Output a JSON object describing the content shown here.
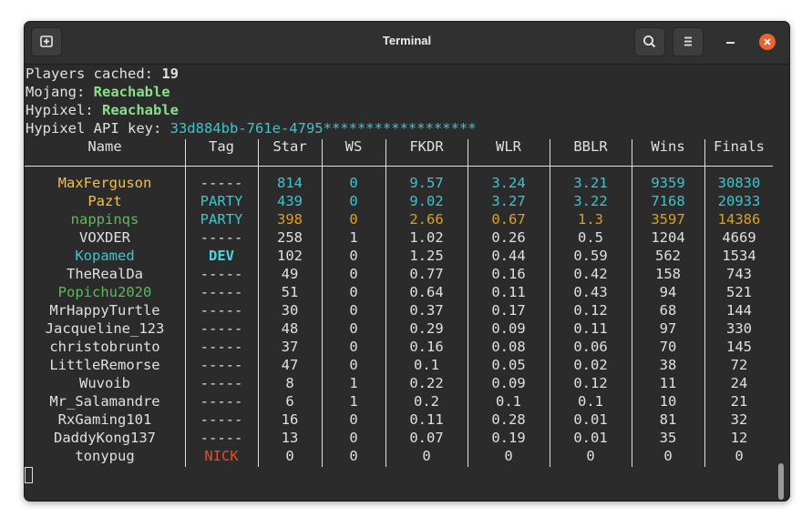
{
  "window": {
    "title": "Terminal"
  },
  "header_lines": [
    {
      "label": "Players cached: ",
      "value": "19",
      "value_style": "b"
    },
    {
      "label": "Mojang: ",
      "value": "Reachable",
      "value_style": "green"
    },
    {
      "label": "Hypixel: ",
      "value": "Reachable",
      "value_style": "green"
    },
    {
      "label": "Hypixel API key: ",
      "value": "33d884bb-761e-4795******************",
      "value_style": "cyan"
    }
  ],
  "table": {
    "columns": [
      "Name",
      "Tag",
      "Star",
      "WS",
      "FKDR",
      "WLR",
      "BBLR",
      "Wins",
      "Finals"
    ],
    "colors": {
      "default": "#e0e0e0",
      "gold": "#f1c04a",
      "cyan": "#3ec4d0",
      "orange": "#e0a020",
      "green": "#5fb95f",
      "red": "#e0502e",
      "aqua_bold": "#49d6e0"
    },
    "rows": [
      {
        "name": "MaxFerguson",
        "name_color": "gold",
        "tag": "-----",
        "tag_color": "default",
        "stats_color": "cyan",
        "star": "814",
        "ws": "0",
        "fkdr": "9.57",
        "wlr": "3.24",
        "bblr": "3.21",
        "wins": "9359",
        "finals": "30830"
      },
      {
        "name": "Pazt",
        "name_color": "gold",
        "tag": "PARTY",
        "tag_color": "cyan",
        "stats_color": "cyan",
        "star": "439",
        "ws": "0",
        "fkdr": "9.02",
        "wlr": "3.27",
        "bblr": "3.22",
        "wins": "7168",
        "finals": "20933"
      },
      {
        "name": "nappinqs",
        "name_color": "green",
        "tag": "PARTY",
        "tag_color": "cyan",
        "stats_color": "orange",
        "star": "398",
        "ws": "0",
        "fkdr": "2.66",
        "wlr": "0.67",
        "bblr": "1.3",
        "wins": "3597",
        "finals": "14386"
      },
      {
        "name": "VOXDER",
        "name_color": "default",
        "tag": "-----",
        "tag_color": "default",
        "stats_color": "default",
        "star": "258",
        "ws": "1",
        "fkdr": "1.02",
        "wlr": "0.26",
        "bblr": "0.5",
        "wins": "1204",
        "finals": "4669"
      },
      {
        "name": "Kopamed",
        "name_color": "cyan",
        "tag": "DEV",
        "tag_color": "aqua_bold",
        "stats_color": "default",
        "star": "102",
        "ws": "0",
        "fkdr": "1.25",
        "wlr": "0.44",
        "bblr": "0.59",
        "wins": "562",
        "finals": "1534"
      },
      {
        "name": "TheRealDa",
        "name_color": "default",
        "tag": "-----",
        "tag_color": "default",
        "stats_color": "default",
        "star": "49",
        "ws": "0",
        "fkdr": "0.77",
        "wlr": "0.16",
        "bblr": "0.42",
        "wins": "158",
        "finals": "743"
      },
      {
        "name": "Popichu2020",
        "name_color": "green",
        "tag": "-----",
        "tag_color": "default",
        "stats_color": "default",
        "star": "51",
        "ws": "0",
        "fkdr": "0.64",
        "wlr": "0.11",
        "bblr": "0.43",
        "wins": "94",
        "finals": "521"
      },
      {
        "name": "MrHappyTurtle",
        "name_color": "default",
        "tag": "-----",
        "tag_color": "default",
        "stats_color": "default",
        "star": "30",
        "ws": "0",
        "fkdr": "0.37",
        "wlr": "0.17",
        "bblr": "0.12",
        "wins": "68",
        "finals": "144"
      },
      {
        "name": "Jacqueline_123",
        "name_color": "default",
        "tag": "-----",
        "tag_color": "default",
        "stats_color": "default",
        "star": "48",
        "ws": "0",
        "fkdr": "0.29",
        "wlr": "0.09",
        "bblr": "0.11",
        "wins": "97",
        "finals": "330"
      },
      {
        "name": "christobrunto",
        "name_color": "default",
        "tag": "-----",
        "tag_color": "default",
        "stats_color": "default",
        "star": "37",
        "ws": "0",
        "fkdr": "0.16",
        "wlr": "0.08",
        "bblr": "0.06",
        "wins": "70",
        "finals": "145"
      },
      {
        "name": "LittleRemorse",
        "name_color": "default",
        "tag": "-----",
        "tag_color": "default",
        "stats_color": "default",
        "star": "47",
        "ws": "0",
        "fkdr": "0.1",
        "wlr": "0.05",
        "bblr": "0.02",
        "wins": "38",
        "finals": "72"
      },
      {
        "name": "Wuvoib",
        "name_color": "default",
        "tag": "-----",
        "tag_color": "default",
        "stats_color": "default",
        "star": "8",
        "ws": "1",
        "fkdr": "0.22",
        "wlr": "0.09",
        "bblr": "0.12",
        "wins": "11",
        "finals": "24"
      },
      {
        "name": "Mr_Salamandre",
        "name_color": "default",
        "tag": "-----",
        "tag_color": "default",
        "stats_color": "default",
        "star": "6",
        "ws": "1",
        "fkdr": "0.2",
        "wlr": "0.1",
        "bblr": "0.1",
        "wins": "10",
        "finals": "21"
      },
      {
        "name": "RxGaming101",
        "name_color": "default",
        "tag": "-----",
        "tag_color": "default",
        "stats_color": "default",
        "star": "16",
        "ws": "0",
        "fkdr": "0.11",
        "wlr": "0.28",
        "bblr": "0.01",
        "wins": "81",
        "finals": "32"
      },
      {
        "name": "DaddyKong137",
        "name_color": "default",
        "tag": "-----",
        "tag_color": "default",
        "stats_color": "default",
        "star": "13",
        "ws": "0",
        "fkdr": "0.07",
        "wlr": "0.19",
        "bblr": "0.01",
        "wins": "35",
        "finals": "12"
      },
      {
        "name": "tonypug",
        "name_color": "default",
        "tag": "NICK",
        "tag_color": "red",
        "stats_color": "default",
        "star": "0",
        "ws": "0",
        "fkdr": "0",
        "wlr": "0",
        "bblr": "0",
        "wins": "0",
        "finals": "0"
      }
    ]
  }
}
